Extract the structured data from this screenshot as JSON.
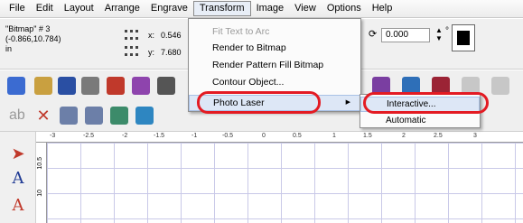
{
  "menubar": {
    "items": [
      "File",
      "Edit",
      "Layout",
      "Arrange",
      "Engrave",
      "Transform",
      "Image",
      "View",
      "Options",
      "Help"
    ]
  },
  "propbar": {
    "object_name": "\"Bitmap\" # 3",
    "object_coords": "(-0.866,10.784)",
    "object_units": "in",
    "x_label": "x:",
    "x_value": "0.546",
    "y_label": "y:",
    "y_value": "7.680",
    "rotation_value": "0.000",
    "rotation_unit": "°"
  },
  "transform_menu": {
    "items": [
      {
        "label": "Fit Text to Arc",
        "state": "disabled"
      },
      {
        "label": "Render to Bitmap",
        "state": "normal"
      },
      {
        "label": "Render Pattern Fill Bitmap",
        "state": "normal"
      },
      {
        "label": "Contour Object...",
        "state": "normal"
      },
      {
        "label": "Photo Laser",
        "state": "highlighted"
      }
    ]
  },
  "photo_laser_submenu": {
    "items": [
      {
        "label": "Interactive...",
        "state": "highlighted"
      },
      {
        "label": "Automatic",
        "state": "normal"
      }
    ]
  },
  "rulers": {
    "horizontal_ticks": [
      "-3",
      "-2.5",
      "-2",
      "-1.5",
      "-1",
      "-0.5",
      "0",
      "0.5",
      "1",
      "1.5",
      "2",
      "2.5",
      "3"
    ],
    "vertical_ticks": [
      "10.5",
      "10"
    ]
  },
  "colors": {
    "callout_red": "#e31b23",
    "menu_highlight": "#dde7f6",
    "grid_line": "#c9c9e8"
  },
  "icons": [
    "arrow-pointer-icon",
    "text-tool-icon",
    "shape-tool-icon"
  ]
}
